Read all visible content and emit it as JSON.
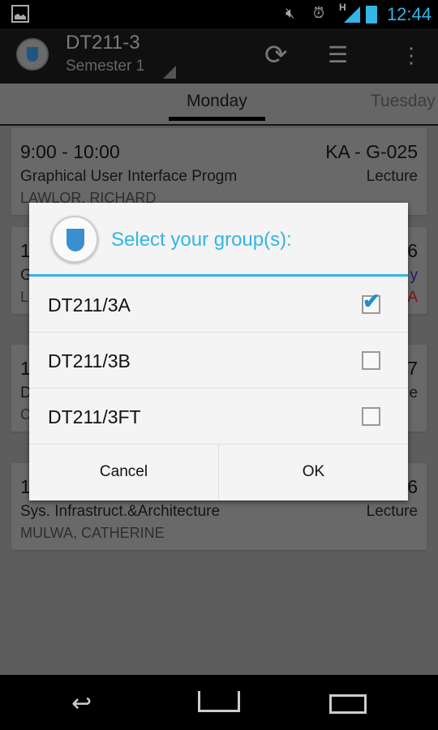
{
  "status_bar": {
    "time": "12:44",
    "icons": [
      "image-icon",
      "mute-icon",
      "alarm-icon",
      "signal-h-icon",
      "battery-icon"
    ]
  },
  "action_bar": {
    "title": "DT211-3",
    "subtitle": "Semester 1",
    "actions": [
      "refresh-icon",
      "settings-sliders-icon",
      "overflow-menu-icon"
    ]
  },
  "tabs": [
    {
      "label": "Monday",
      "selected": true
    },
    {
      "label": "Tuesday",
      "selected": false
    }
  ],
  "cards": [
    {
      "time": "9:00 - 10:00",
      "room": "KA - G-025",
      "module": "Graphical User Interface Progm",
      "type": "Lecture",
      "lecturer": "LAWLOR, RICHARD"
    },
    {
      "time": "1",
      "room": "6",
      "module": "G",
      "type": "y",
      "lecturer": "L",
      "type_color": "#3333aa",
      "extra": "A",
      "extra_color": "#cc2222"
    },
    {
      "time": "1",
      "room": "7",
      "module": "D",
      "type": "e",
      "lecturer": "C"
    },
    {
      "time": "1",
      "room": "6",
      "module": "Sys. Infrastruct.&Architecture",
      "type": "Lecture",
      "lecturer": "MULWA, CATHERINE"
    }
  ],
  "dialog": {
    "title": "Select your group(s):",
    "options": [
      {
        "label": "DT211/3A",
        "checked": true
      },
      {
        "label": "DT211/3B",
        "checked": false
      },
      {
        "label": "DT211/3FT",
        "checked": false
      }
    ],
    "cancel": "Cancel",
    "ok": "OK"
  },
  "colors": {
    "accent": "#33b5e5"
  }
}
